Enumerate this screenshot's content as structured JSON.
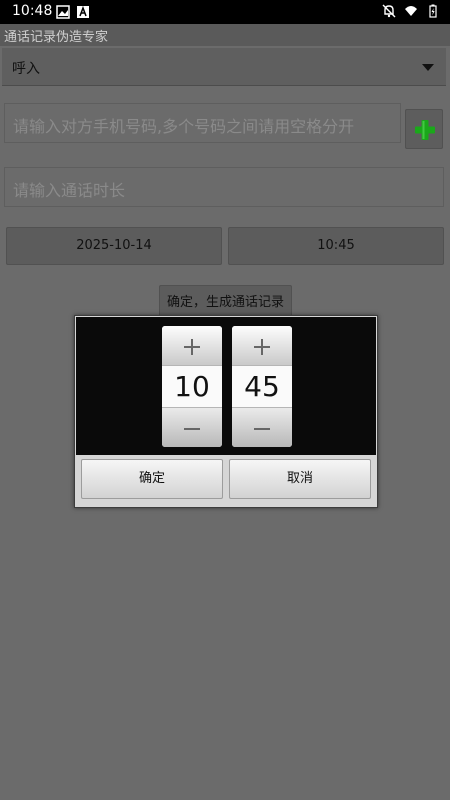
{
  "status_bar": {
    "time": "10:48"
  },
  "app": {
    "title": "通话记录伪造专家"
  },
  "call_type": {
    "selected": "呼入"
  },
  "phone_input": {
    "placeholder": "请输入对方手机号码,多个号码之间请用空格分开"
  },
  "duration_input": {
    "placeholder": "请输入通话时长"
  },
  "date_button": {
    "label": "2025-10-14"
  },
  "time_button": {
    "label": "10:45"
  },
  "generate_button": {
    "label": "确定，生成通话记录"
  },
  "time_picker": {
    "hour": "10",
    "minute": "45",
    "confirm_label": "确定",
    "cancel_label": "取消"
  },
  "colors": {
    "accent_green": "#1aa81a",
    "background": "#6b6b6b",
    "dialog_dark": "#0a0a0a"
  }
}
